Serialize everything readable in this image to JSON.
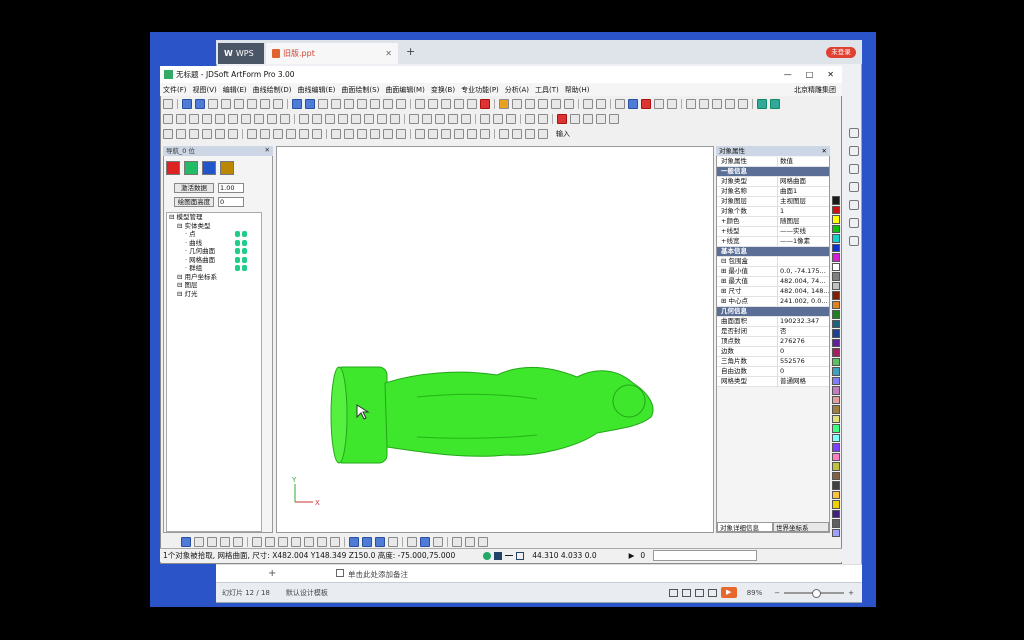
{
  "wps": {
    "tabs": [
      {
        "label": "WPS",
        "icon": "wps-logo-icon"
      },
      {
        "label": "旧版.ppt",
        "icon": "ppt-file-icon"
      }
    ],
    "new_tab": "+",
    "login_button": "未登录",
    "notes_add": "+",
    "notes_placeholder": "单击此处添加备注",
    "slide_counter": "幻灯片 12 / 18",
    "theme_label": "默认设计模板",
    "zoom": "89%",
    "zoom_minus": "−",
    "zoom_plus": "+"
  },
  "app": {
    "title": "无标题 - JDSoft ArtForm Pro 3.00",
    "window_controls": {
      "min": "—",
      "max": "□",
      "close": "✕"
    },
    "menus": [
      "文件(F)",
      "视图(V)",
      "编辑(E)",
      "曲线绘制(D)",
      "曲线编辑(E)",
      "曲面绘制(S)",
      "曲面编辑(M)",
      "变换(B)",
      "专业功能(P)",
      "分析(A)",
      "工具(T)",
      "帮助(H)"
    ],
    "company": "北京精雕集团",
    "input_button": "输入"
  },
  "left_panel": {
    "header": "导航_0 位",
    "fields": [
      {
        "label": "激活数据",
        "value": "1.00"
      },
      {
        "label": "绘图面高度",
        "value": "0"
      }
    ],
    "tree": [
      {
        "label": "模型管理",
        "indent": 0,
        "pins": 0
      },
      {
        "label": "实体类型",
        "indent": 1,
        "pins": 0
      },
      {
        "label": "点",
        "indent": 2,
        "pins": 2
      },
      {
        "label": "曲线",
        "indent": 2,
        "pins": 2
      },
      {
        "label": "几何曲面",
        "indent": 2,
        "pins": 2
      },
      {
        "label": "网格曲面",
        "indent": 2,
        "pins": 2
      },
      {
        "label": "群组",
        "indent": 2,
        "pins": 2
      },
      {
        "label": "用户坐标系",
        "indent": 1,
        "pins": 0
      },
      {
        "label": "图层",
        "indent": 1,
        "pins": 0
      },
      {
        "label": "灯光",
        "indent": 1,
        "pins": 0
      }
    ]
  },
  "properties": {
    "header": "对象属性",
    "col_headers": [
      "对象属性",
      "数值"
    ],
    "rows": [
      {
        "type": "group",
        "k": "一般信息"
      },
      {
        "k": "对象类型",
        "v": "网格曲面"
      },
      {
        "k": "对象名称",
        "v": "曲面1"
      },
      {
        "k": "对象图层",
        "v": "主视图层"
      },
      {
        "k": "对象个数",
        "v": "1"
      },
      {
        "k": "+颜色",
        "v": "随图层"
      },
      {
        "k": "+线型",
        "v": "——实线"
      },
      {
        "k": "+线宽",
        "v": "——1像素"
      },
      {
        "type": "group",
        "k": "基本信息"
      },
      {
        "k": "⊟ 包围盒",
        "v": ""
      },
      {
        "k": "  ⊞ 最小值",
        "v": "0.0, -74.175..."
      },
      {
        "k": "  ⊞ 最大值",
        "v": "482.004, 74..."
      },
      {
        "k": "⊞ 尺寸",
        "v": "482.004, 148..."
      },
      {
        "k": "⊞ 中心点",
        "v": "241.002, 0.0..."
      },
      {
        "type": "group",
        "k": "几何信息"
      },
      {
        "k": "曲面面积",
        "v": "190232.347"
      },
      {
        "k": "是否封闭",
        "v": "否"
      },
      {
        "k": "顶点数",
        "v": "276276"
      },
      {
        "k": "边数",
        "v": "0"
      },
      {
        "k": "三角片数",
        "v": "552576"
      },
      {
        "k": "自由边数",
        "v": "0"
      },
      {
        "k": "网格类型",
        "v": "普通网格"
      }
    ],
    "bottom_tabs": [
      "对象详细信息",
      "世界坐标系"
    ]
  },
  "viewport": {
    "axis_x": "X",
    "axis_y": "Y",
    "model_color": "#3ee62c"
  },
  "status": {
    "text": "1个对象被拾取, 网格曲面, 尺寸: X482.004 Y148.349 Z150.0 高度: -75.000,75.000",
    "coords": "44.310  4.033  0.0",
    "play": "▶",
    "zero": "0"
  },
  "palette": [
    "#1a1a1a",
    "#d01010",
    "#ffff00",
    "#10c010",
    "#10d0d0",
    "#1030d0",
    "#d020d0",
    "#ffffff",
    "#808080",
    "#c0c0c0",
    "#802000",
    "#e08020",
    "#208020",
    "#206080",
    "#204090",
    "#6020a0",
    "#a02060",
    "#60c060",
    "#40a0c0",
    "#8080ff",
    "#c080c0",
    "#e0a0a0",
    "#a08040",
    "#e0e080",
    "#40ff80",
    "#80ffff",
    "#8040ff",
    "#ff80c0",
    "#c0c040",
    "#806040",
    "#404040",
    "#ffc040",
    "#f0d000",
    "#402080",
    "#606060",
    "#a0a0ff"
  ]
}
